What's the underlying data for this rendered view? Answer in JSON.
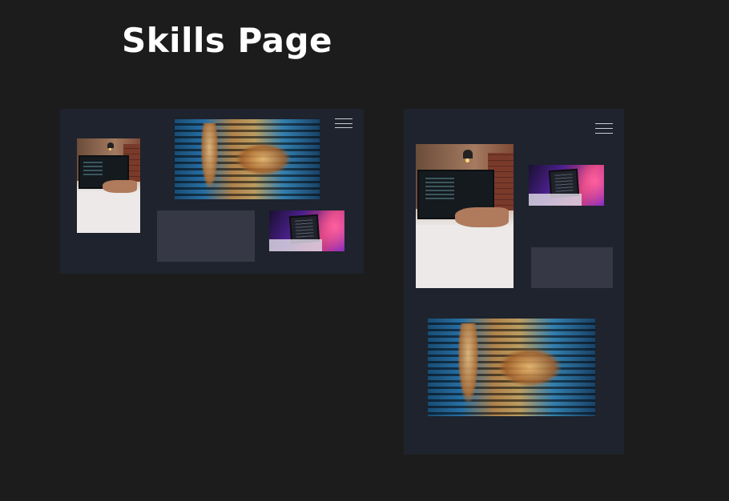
{
  "page": {
    "title": "Skills Page",
    "background": "#1c1c1c"
  },
  "frames": {
    "desktop": {
      "background": "#1f232d",
      "menu_icon": "hamburger-menu-icon",
      "images": [
        "desk-workstation-photo",
        "code-projection-hands-photo",
        "neon-laptop-photo"
      ]
    },
    "mobile": {
      "background": "#1f232d",
      "menu_icon": "hamburger-menu-icon",
      "images": [
        "desk-workstation-photo",
        "neon-laptop-photo",
        "code-projection-hands-photo"
      ]
    }
  },
  "colors": {
    "placeholder_block": "#363945",
    "menu_lines": "#c9ccd2"
  }
}
